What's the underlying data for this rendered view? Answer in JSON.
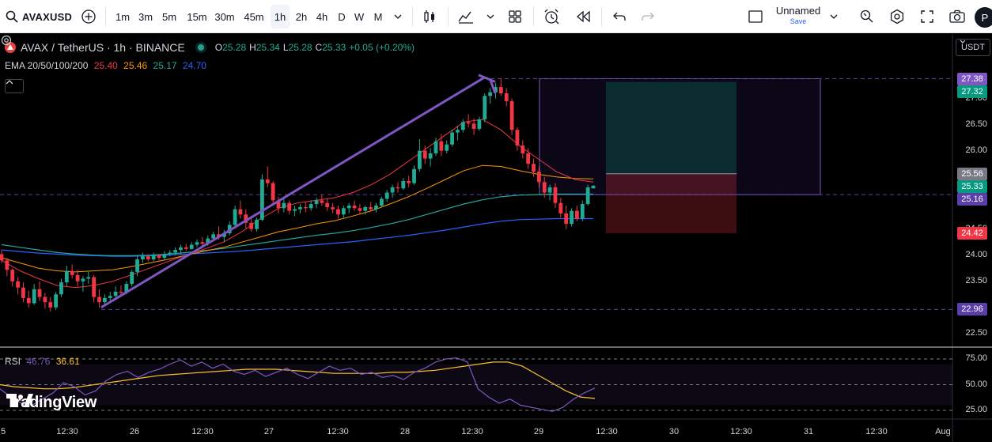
{
  "toolbar": {
    "symbol": "AVAXUSD",
    "intervals": [
      "1m",
      "3m",
      "5m",
      "15m",
      "30m",
      "45m",
      "1h",
      "2h",
      "4h",
      "D",
      "W",
      "M"
    ],
    "active_interval": "1h",
    "layout_name": "Unnamed",
    "layout_status": "Save",
    "avatar_letter": "P",
    "icons": [
      "search-icon",
      "add-compare-icon",
      "chevron-down-icon",
      "candles-icon",
      "indicators-icon",
      "templates-icon",
      "alert-icon",
      "replay-icon",
      "undo-icon",
      "redo-icon",
      "fullscreen-icon",
      "camera-icon",
      "settings-icon"
    ]
  },
  "legend": {
    "title": "AVAX / TetherUS · 1h · BINANCE",
    "o_label": "O",
    "o_value": "25.28",
    "h_label": "H",
    "h_value": "25.34",
    "l_label": "L",
    "l_value": "25.28",
    "c_label": "C",
    "c_value": "25.33",
    "change": "+0.05 (+0.20%)",
    "ema_label": "EMA 20/50/100/200",
    "ema_values": [
      "25.40",
      "25.46",
      "25.17",
      "24.70"
    ]
  },
  "rsi": {
    "label": "RSI",
    "value": "46.76",
    "ma_value": "36.61",
    "levels": [
      "75.00",
      "50.00",
      "25.00"
    ]
  },
  "price_scale": {
    "currency": "USDT",
    "ticks": [
      "27.00",
      "26.50",
      "26.00",
      "24.50",
      "24.00",
      "23.50",
      "23.00",
      "22.50"
    ],
    "badges": [
      {
        "value": "27.38",
        "color": "#7e57c2"
      },
      {
        "value": "27.32",
        "color": "#089981"
      },
      {
        "value": "25.56",
        "color": "#787b86"
      },
      {
        "value": "25.33",
        "color": "#089981"
      },
      {
        "value": "25.16",
        "color": "#5b3fa8"
      },
      {
        "value": "24.42",
        "color": "#f23645"
      },
      {
        "value": "22.96",
        "color": "#5b3fa8"
      }
    ]
  },
  "time_scale": [
    "5",
    "12:30",
    "26",
    "12:30",
    "27",
    "12:30",
    "28",
    "12:30",
    "29",
    "12:30",
    "30",
    "12:30",
    "31",
    "12:30",
    "Aug"
  ],
  "watermark": "TradingView",
  "colors": {
    "up": "#22ab94",
    "down": "#f23645",
    "ema20": "#f23645",
    "ema50": "#ff9800",
    "ema100": "#26a69a",
    "ema200": "#2962ff",
    "trendline": "#7e57c2",
    "rsi_line": "#7e57c2",
    "rsi_ma": "#fbc02d"
  },
  "chart_data": {
    "type": "candlestick",
    "interval": "1h",
    "candles": [
      [
        24.02,
        24.1,
        23.85,
        23.9
      ],
      [
        23.9,
        23.95,
        23.6,
        23.72
      ],
      [
        23.72,
        23.75,
        23.4,
        23.5
      ],
      [
        23.5,
        23.58,
        23.25,
        23.38
      ],
      [
        23.38,
        23.48,
        23.1,
        23.18
      ],
      [
        23.18,
        23.32,
        23.0,
        23.08
      ],
      [
        23.08,
        23.45,
        23.05,
        23.35
      ],
      [
        23.35,
        23.5,
        23.12,
        23.2
      ],
      [
        23.2,
        23.28,
        22.98,
        23.1
      ],
      [
        23.1,
        23.2,
        22.92,
        23.0
      ],
      [
        23.0,
        23.3,
        22.95,
        23.25
      ],
      [
        23.25,
        23.55,
        23.2,
        23.48
      ],
      [
        23.48,
        23.8,
        23.4,
        23.7
      ],
      [
        23.7,
        23.82,
        23.55,
        23.62
      ],
      [
        23.62,
        23.72,
        23.4,
        23.5
      ],
      [
        23.5,
        23.6,
        23.3,
        23.55
      ],
      [
        23.55,
        23.7,
        23.45,
        23.58
      ],
      [
        23.58,
        23.62,
        23.1,
        23.2
      ],
      [
        23.2,
        23.35,
        23.0,
        23.1
      ],
      [
        23.1,
        23.25,
        23.02,
        23.18
      ],
      [
        23.18,
        23.3,
        23.1,
        23.22
      ],
      [
        23.22,
        23.4,
        23.15,
        23.3
      ],
      [
        23.3,
        23.42,
        23.2,
        23.28
      ],
      [
        23.28,
        23.5,
        23.25,
        23.45
      ],
      [
        23.45,
        23.72,
        23.4,
        23.68
      ],
      [
        23.68,
        24.0,
        23.6,
        23.92
      ],
      [
        23.92,
        24.05,
        23.85,
        23.98
      ],
      [
        23.98,
        24.02,
        23.88,
        23.92
      ],
      [
        23.92,
        24.05,
        23.88,
        24.0
      ],
      [
        24.0,
        24.02,
        23.9,
        23.95
      ],
      [
        23.95,
        24.08,
        23.9,
        24.02
      ],
      [
        24.02,
        24.1,
        23.98,
        24.05
      ],
      [
        24.05,
        24.15,
        24.0,
        24.1
      ],
      [
        24.1,
        24.2,
        24.02,
        24.15
      ],
      [
        24.15,
        24.22,
        24.08,
        24.12
      ],
      [
        24.12,
        24.25,
        24.1,
        24.2
      ],
      [
        24.2,
        24.3,
        24.15,
        24.25
      ],
      [
        24.25,
        24.35,
        24.15,
        24.22
      ],
      [
        24.22,
        24.38,
        24.18,
        24.32
      ],
      [
        24.32,
        24.45,
        24.28,
        24.4
      ],
      [
        24.4,
        24.55,
        24.3,
        24.35
      ],
      [
        24.35,
        24.48,
        24.25,
        24.42
      ],
      [
        24.42,
        24.65,
        24.38,
        24.58
      ],
      [
        24.58,
        24.95,
        24.52,
        24.88
      ],
      [
        24.88,
        25.05,
        24.7,
        24.78
      ],
      [
        24.78,
        24.88,
        24.5,
        24.62
      ],
      [
        24.62,
        24.75,
        24.45,
        24.5
      ],
      [
        24.5,
        24.72,
        24.45,
        24.68
      ],
      [
        24.68,
        25.55,
        24.65,
        25.45
      ],
      [
        25.45,
        25.7,
        25.3,
        25.38
      ],
      [
        25.38,
        25.42,
        24.95,
        25.05
      ],
      [
        25.05,
        25.12,
        24.8,
        24.9
      ],
      [
        24.9,
        25.1,
        24.82,
        25.0
      ],
      [
        25.0,
        25.05,
        24.78,
        24.85
      ],
      [
        24.85,
        24.95,
        24.75,
        24.88
      ],
      [
        24.88,
        24.98,
        24.8,
        24.92
      ],
      [
        24.92,
        25.02,
        24.82,
        24.9
      ],
      [
        24.9,
        25.05,
        24.85,
        24.98
      ],
      [
        24.98,
        25.1,
        24.9,
        25.05
      ],
      [
        25.05,
        25.15,
        24.95,
        25.0
      ],
      [
        25.0,
        25.08,
        24.85,
        24.92
      ],
      [
        24.92,
        25.0,
        24.8,
        24.88
      ],
      [
        24.88,
        24.95,
        24.7,
        24.78
      ],
      [
        24.78,
        24.95,
        24.72,
        24.9
      ],
      [
        24.9,
        25.0,
        24.8,
        24.95
      ],
      [
        24.95,
        25.05,
        24.85,
        24.9
      ],
      [
        24.9,
        24.98,
        24.8,
        24.85
      ],
      [
        24.85,
        24.95,
        24.78,
        24.92
      ],
      [
        24.92,
        25.02,
        24.85,
        24.88
      ],
      [
        24.88,
        25.0,
        24.82,
        24.95
      ],
      [
        24.95,
        25.12,
        24.92,
        25.08
      ],
      [
        25.08,
        25.25,
        25.02,
        25.2
      ],
      [
        25.2,
        25.35,
        25.1,
        25.3
      ],
      [
        25.3,
        25.4,
        25.2,
        25.28
      ],
      [
        25.28,
        25.48,
        25.25,
        25.42
      ],
      [
        25.42,
        25.52,
        25.3,
        25.38
      ],
      [
        25.38,
        25.72,
        25.35,
        25.65
      ],
      [
        25.65,
        26.22,
        25.6,
        26.0
      ],
      [
        26.0,
        26.1,
        25.75,
        25.85
      ],
      [
        25.85,
        26.05,
        25.7,
        25.95
      ],
      [
        25.95,
        26.25,
        25.9,
        26.18
      ],
      [
        26.18,
        26.32,
        25.9,
        26.0
      ],
      [
        26.0,
        26.2,
        25.95,
        26.12
      ],
      [
        26.12,
        26.4,
        26.08,
        26.35
      ],
      [
        26.35,
        26.48,
        26.2,
        26.4
      ],
      [
        26.4,
        26.6,
        26.35,
        26.55
      ],
      [
        26.55,
        26.7,
        26.45,
        26.52
      ],
      [
        26.52,
        26.62,
        26.3,
        26.42
      ],
      [
        26.42,
        26.65,
        26.38,
        26.6
      ],
      [
        26.6,
        27.1,
        26.55,
        27.05
      ],
      [
        27.05,
        27.2,
        26.9,
        27.12
      ],
      [
        27.12,
        27.3,
        27.0,
        27.22
      ],
      [
        27.22,
        27.38,
        27.05,
        27.1
      ],
      [
        27.1,
        27.2,
        26.85,
        26.95
      ],
      [
        26.95,
        27.0,
        26.3,
        26.4
      ],
      [
        26.4,
        26.45,
        26.0,
        26.1
      ],
      [
        26.1,
        26.2,
        25.85,
        25.95
      ],
      [
        25.95,
        26.05,
        25.65,
        25.75
      ],
      [
        25.75,
        25.85,
        25.5,
        25.6
      ],
      [
        25.6,
        25.7,
        25.3,
        25.4
      ],
      [
        25.4,
        25.5,
        25.1,
        25.2
      ],
      [
        25.2,
        25.35,
        25.05,
        25.3
      ],
      [
        25.3,
        25.38,
        24.9,
        25.0
      ],
      [
        25.0,
        25.1,
        24.72,
        24.8
      ],
      [
        24.8,
        24.95,
        24.5,
        24.6
      ],
      [
        24.6,
        24.9,
        24.55,
        24.85
      ],
      [
        24.85,
        24.95,
        24.65,
        24.7
      ],
      [
        24.7,
        25.05,
        24.65,
        24.98
      ],
      [
        24.98,
        25.35,
        24.95,
        25.3
      ],
      [
        25.28,
        25.34,
        25.28,
        25.33
      ]
    ],
    "ema": {
      "20": [
        23.9,
        23.7,
        23.55,
        23.42,
        23.38,
        23.42,
        23.5,
        23.62,
        23.75,
        23.88,
        24.0,
        24.12,
        24.25,
        24.45,
        24.7,
        24.9,
        25.0,
        25.05,
        25.1,
        25.2,
        25.35,
        25.55,
        25.8,
        26.05,
        26.3,
        26.55,
        26.6,
        26.4,
        26.1,
        25.85,
        25.6,
        25.45,
        25.4
      ],
      "50": [
        23.95,
        23.85,
        23.75,
        23.7,
        23.68,
        23.7,
        23.72,
        23.78,
        23.85,
        23.92,
        24.0,
        24.08,
        24.15,
        24.25,
        24.35,
        24.45,
        24.52,
        24.6,
        24.66,
        24.75,
        24.85,
        24.98,
        25.12,
        25.28,
        25.45,
        25.62,
        25.72,
        25.7,
        25.62,
        25.55,
        25.5,
        25.47,
        25.46
      ],
      "100": [
        24.2,
        24.15,
        24.1,
        24.05,
        24.02,
        24.0,
        23.99,
        23.99,
        24.0,
        24.02,
        24.05,
        24.09,
        24.13,
        24.18,
        24.23,
        24.28,
        24.33,
        24.38,
        24.42,
        24.47,
        24.53,
        24.6,
        24.68,
        24.78,
        24.88,
        24.98,
        25.06,
        25.12,
        25.15,
        25.16,
        25.17,
        25.17,
        25.17
      ],
      "200": [
        24.1,
        24.07,
        24.04,
        24.02,
        24.0,
        23.99,
        23.98,
        23.98,
        23.99,
        24.0,
        24.02,
        24.04,
        24.06,
        24.08,
        24.11,
        24.14,
        24.17,
        24.2,
        24.23,
        24.26,
        24.3,
        24.34,
        24.38,
        24.43,
        24.48,
        24.54,
        24.6,
        24.65,
        24.68,
        24.69,
        24.7,
        24.7,
        24.7
      ]
    },
    "rsi": [
      46,
      38,
      32,
      30,
      36,
      42,
      52,
      48,
      40,
      44,
      54,
      60,
      63,
      57,
      62,
      65,
      70,
      74,
      68,
      72,
      66,
      70,
      63,
      60,
      64,
      58,
      62,
      66,
      60,
      56,
      62,
      68,
      64,
      66,
      60,
      62,
      57,
      59,
      55,
      62,
      66,
      72,
      75,
      76,
      72,
      46,
      38,
      32,
      36,
      30,
      28,
      26,
      24,
      28,
      36,
      42,
      46.76
    ],
    "rsi_ma": [
      50,
      48,
      47,
      46,
      46,
      47,
      49,
      51,
      53,
      55,
      57,
      59,
      60,
      61,
      62,
      63,
      64,
      65,
      65,
      65,
      64,
      63,
      62,
      61,
      61,
      61,
      61,
      62,
      62,
      63,
      64,
      66,
      68,
      70,
      72,
      72,
      68,
      60,
      52,
      44,
      38,
      36.61
    ],
    "trendline": {
      "from": [
        23.0,
        "bar 10"
      ],
      "to": [
        27.38,
        "bar 92"
      ]
    },
    "position": {
      "entry": 25.56,
      "target": 27.32,
      "stop": 24.42
    },
    "horizontal_levels": [
      27.38,
      25.16,
      22.96
    ],
    "y_range": [
      22.3,
      27.6
    ],
    "rsi_levels": [
      75,
      50,
      25
    ]
  }
}
